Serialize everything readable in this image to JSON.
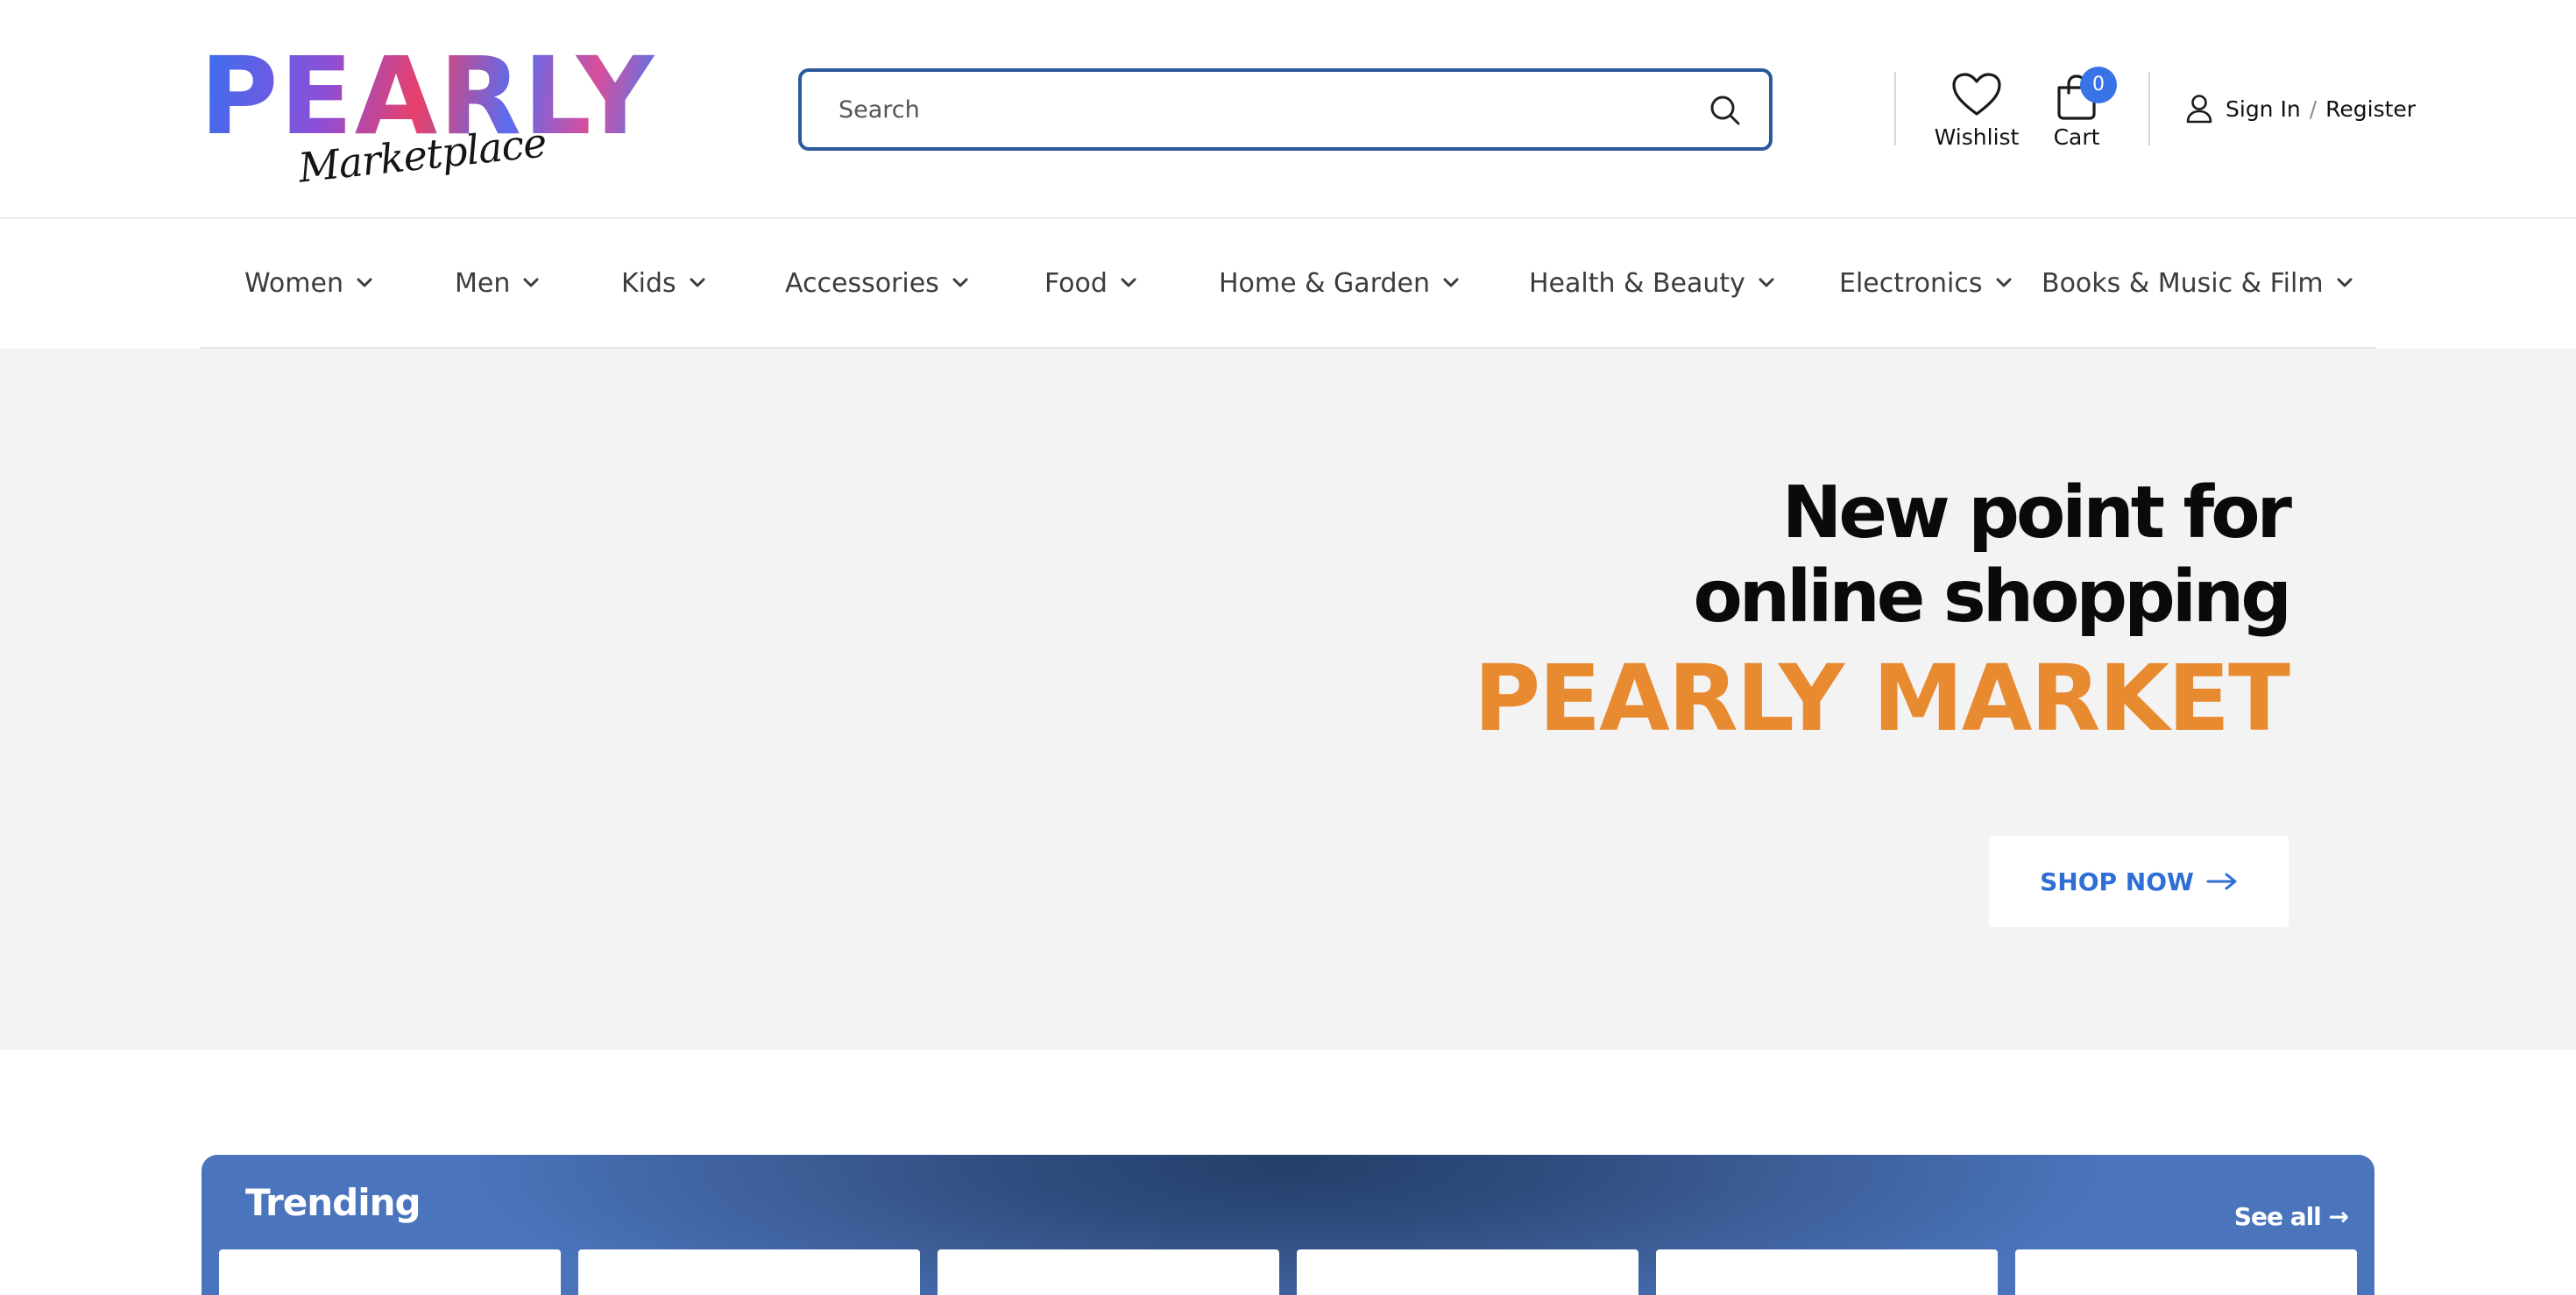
{
  "header": {
    "logo": {
      "word": "PEARLY",
      "sub": "Marketplace"
    },
    "search": {
      "placeholder": "Search",
      "value": ""
    },
    "wishlist_label": "Wishlist",
    "cart_label": "Cart",
    "cart_count": "0",
    "sign_in": "Sign In",
    "separator": "/",
    "register": "Register",
    "icons": [
      "search-icon",
      "heart-icon",
      "shopping-bag-icon",
      "user-icon"
    ],
    "colors": {
      "search_border": "#2a5a9c",
      "cart_badge": "#3874e8"
    }
  },
  "nav": {
    "items": [
      {
        "label": "Women"
      },
      {
        "label": "Men"
      },
      {
        "label": "Kids"
      },
      {
        "label": "Accessories"
      },
      {
        "label": "Food"
      },
      {
        "label": "Home & Garden"
      },
      {
        "label": "Health & Beauty"
      },
      {
        "label": "Electronics"
      },
      {
        "label": "Books & Music & Film"
      }
    ]
  },
  "hero": {
    "line1": "New point for",
    "line2": "online shopping",
    "line3": "PEARLY MARKET",
    "button": "SHOP NOW",
    "colors": {
      "accent": "#e88a30",
      "button_text": "#2e6ed6",
      "background": "#f3f3f3"
    }
  },
  "trending": {
    "title": "Trending",
    "see_all": "See all →",
    "colors": {
      "gradient_dark": "#253f6a",
      "gradient_light": "#4a75bd"
    }
  }
}
